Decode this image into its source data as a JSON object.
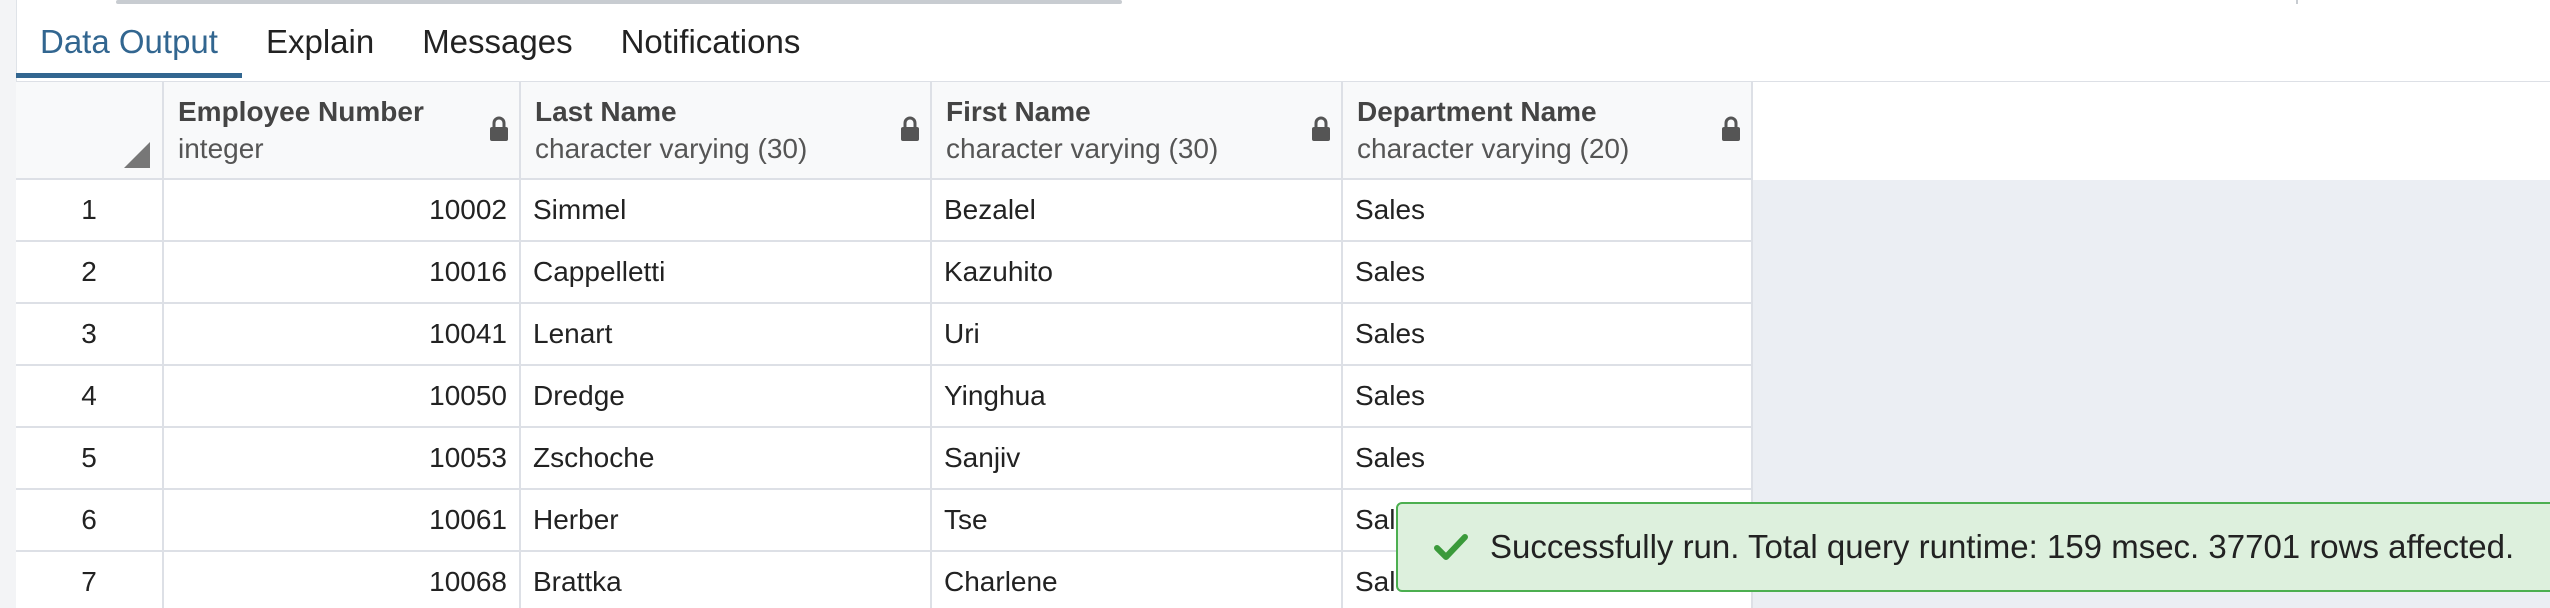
{
  "tabs": [
    {
      "label": "Data Output",
      "active": true
    },
    {
      "label": "Explain",
      "active": false
    },
    {
      "label": "Messages",
      "active": false
    },
    {
      "label": "Notifications",
      "active": false
    }
  ],
  "grid": {
    "columns": [
      {
        "name": "Employee Number",
        "type": "integer",
        "locked": true,
        "align": "right"
      },
      {
        "name": "Last Name",
        "type": "character varying (30)",
        "locked": true,
        "align": "left"
      },
      {
        "name": "First Name",
        "type": "character varying (30)",
        "locked": true,
        "align": "left"
      },
      {
        "name": "Department Name",
        "type": "character varying (20)",
        "locked": true,
        "align": "left"
      }
    ],
    "rows": [
      {
        "num": "1",
        "cells": [
          "10002",
          "Simmel",
          "Bezalel",
          "Sales"
        ]
      },
      {
        "num": "2",
        "cells": [
          "10016",
          "Cappelletti",
          "Kazuhito",
          "Sales"
        ]
      },
      {
        "num": "3",
        "cells": [
          "10041",
          "Lenart",
          "Uri",
          "Sales"
        ]
      },
      {
        "num": "4",
        "cells": [
          "10050",
          "Dredge",
          "Yinghua",
          "Sales"
        ]
      },
      {
        "num": "5",
        "cells": [
          "10053",
          "Zschoche",
          "Sanjiv",
          "Sales"
        ]
      },
      {
        "num": "6",
        "cells": [
          "10061",
          "Herber",
          "Tse",
          "Sales"
        ]
      },
      {
        "num": "7",
        "cells": [
          "10068",
          "Brattka",
          "Charlene",
          "Sales"
        ]
      }
    ]
  },
  "toast": {
    "message": "Successfully run. Total query runtime: 159 msec. 37701 rows affected.",
    "icon": "check-icon"
  },
  "colors": {
    "accent": "#326690",
    "toast_bg": "#ddf0dd",
    "toast_border": "#4caf50",
    "check": "#3a9a3a"
  }
}
